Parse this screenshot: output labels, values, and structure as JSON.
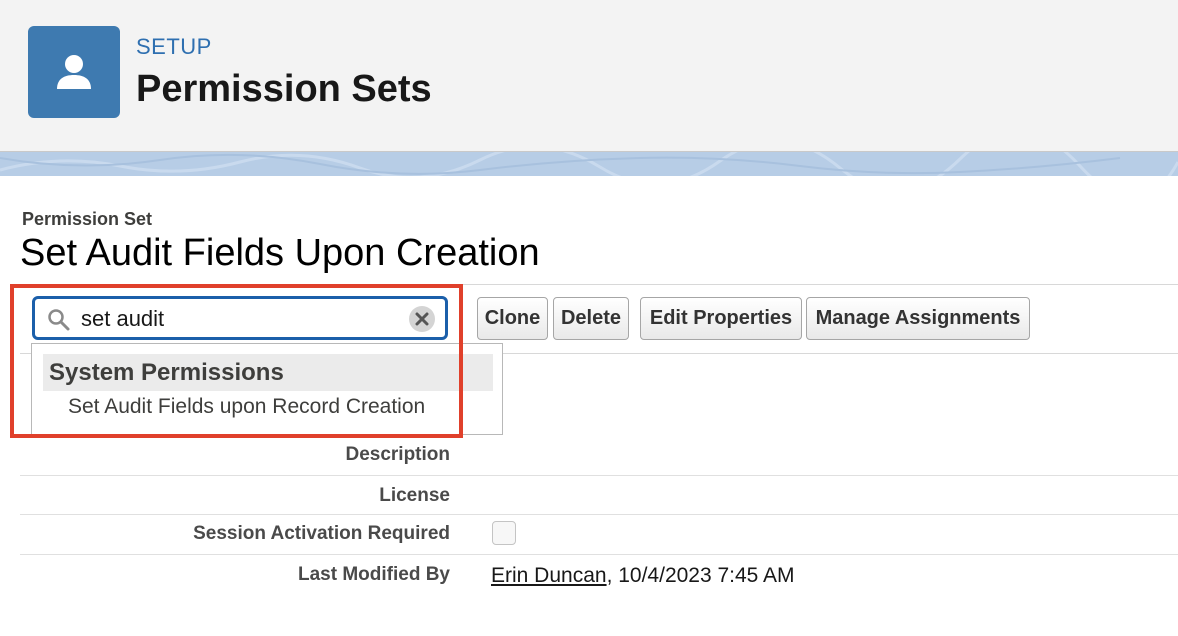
{
  "header": {
    "setup_label": "SETUP",
    "title": "Permission Sets",
    "icon": "user-icon",
    "icon_color": "#3e7ab0"
  },
  "record": {
    "type_label": "Permission Set",
    "title": "Set Audit Fields Upon Creation"
  },
  "search": {
    "value": "set audit",
    "border_color": "#1b5faa"
  },
  "toolbar": {
    "buttons": [
      "Clone",
      "Delete",
      "Edit Properties",
      "Manage Assignments"
    ]
  },
  "dropdown": {
    "section_header": "System Permissions",
    "items": [
      "Set Audit Fields upon Record Creation"
    ]
  },
  "highlight_color": "#e0402b",
  "fields": {
    "description_label": "Description",
    "license_label": "License",
    "session_label": "Session Activation Required",
    "session_checked": false,
    "last_modified_label": "Last Modified By",
    "last_modified_user": "Erin Duncan",
    "last_modified_date": ", 10/4/2023 7:45 AM"
  }
}
